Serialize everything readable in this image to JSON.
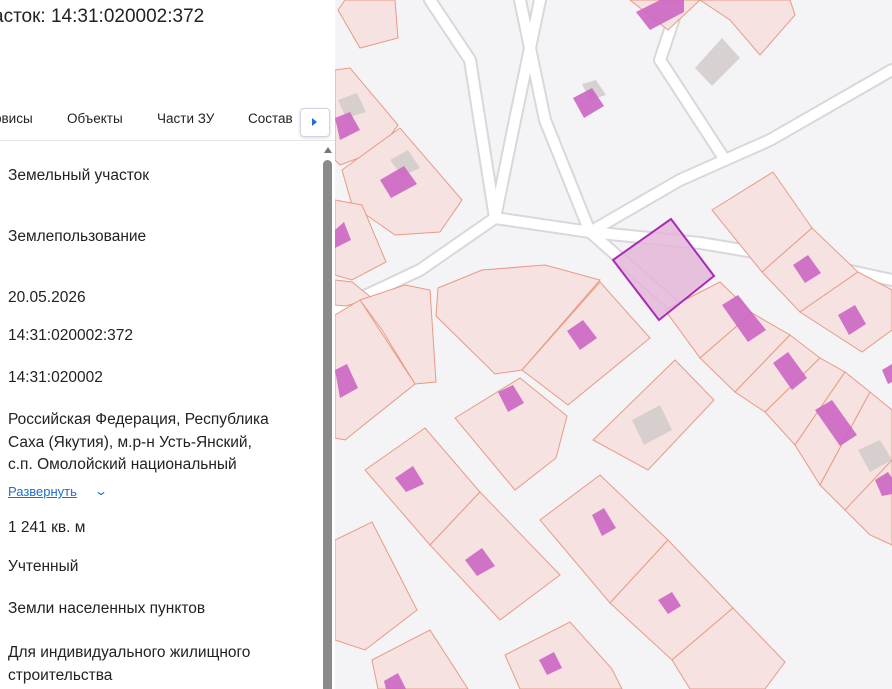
{
  "title": "асток: 14:31:020002:372",
  "tabs": [
    "рвисы",
    "Объекты",
    "Части ЗУ",
    "Состав"
  ],
  "fields": {
    "type": "Земельный участок",
    "form": "Землепользование",
    "date": "20.05.2026",
    "cadastral_number": "14:31:020002:372",
    "quarter": "14:31:020002",
    "address_1": "Российская Федерация, Республика",
    "address_2": "Саха (Якутия), м.р-н Усть-Янский,",
    "address_3": "с.п. Омолойский национальный",
    "expand_label": "Развернуть",
    "area": "1 241 кв. м",
    "status": "Учтенный",
    "category": "Земли населенных пунктов",
    "use_1": "Для индивидуального жилищного",
    "use_2": "строительства"
  },
  "map_colors": {
    "parcel_fill": "#f6e3e1",
    "parcel_stroke": "#e99a85",
    "building_fill": "#cc66c4",
    "building_grey": "#c9c4c4",
    "road": "#ffffff",
    "selected_stroke": "#a82bb3",
    "selected_fill": "#e3b6d8"
  }
}
